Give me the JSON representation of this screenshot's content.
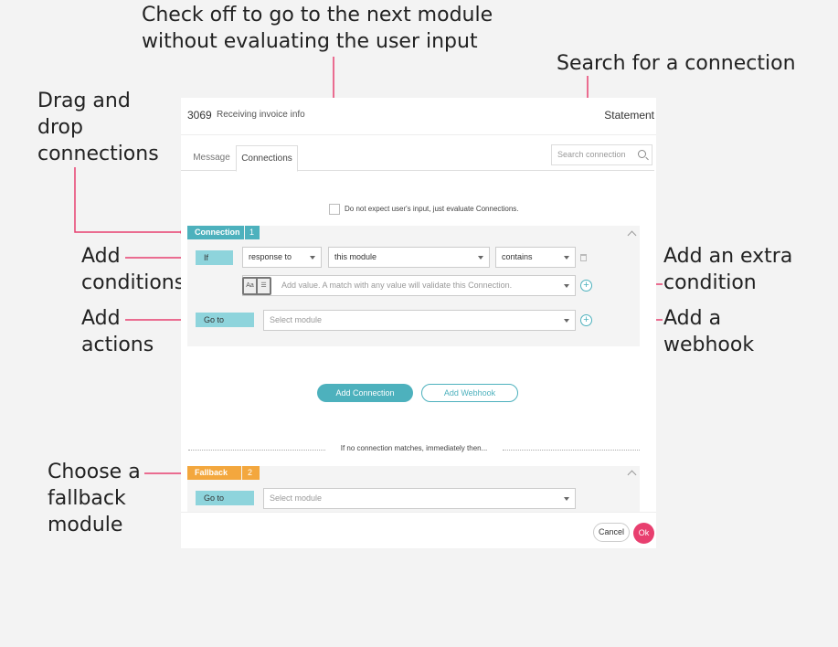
{
  "annotations": {
    "check_off": "Check off to go to the next module\nwithout evaluating the user input",
    "search": "Search for a connection",
    "drag": "Drag and\ndrop\nconnections",
    "conditions": "Add\nconditions",
    "extra_condition": "Add an extra\ncondition",
    "actions": "Add\nactions",
    "webhook": "Add a\nwebhook",
    "fallback": "Choose a\nfallback\nmodule"
  },
  "dialog": {
    "module_id": "3069",
    "module_name": "Receiving invoice info",
    "module_type": "Statement",
    "tabs": [
      {
        "label": "Message"
      },
      {
        "label": "Connections"
      }
    ],
    "search_placeholder": "Search connection",
    "checkbox_label": "Do not expect user's input, just evaluate Connections.",
    "connection": {
      "label": "Connection",
      "number": "1",
      "if_label": "If",
      "field": "response to",
      "target": "this module",
      "operator": "contains",
      "value_placeholder": "Add value. A match with any value will validate this Connection.",
      "goto_label": "Go to",
      "goto_placeholder": "Select module"
    },
    "add_connection_label": "Add Connection",
    "add_webhook_label": "Add Webhook",
    "separator_text": "If no connection matches, immediately then...",
    "fallback": {
      "label": "Fallback",
      "number": "2",
      "goto_label": "Go to",
      "goto_placeholder": "Select module"
    },
    "cancel_label": "Cancel",
    "ok_label": "Ok"
  },
  "colors": {
    "accent": "#4db1bd",
    "fallback": "#f3a73e",
    "primary": "#e83f6f",
    "annotation_line": "#e83f6f"
  }
}
